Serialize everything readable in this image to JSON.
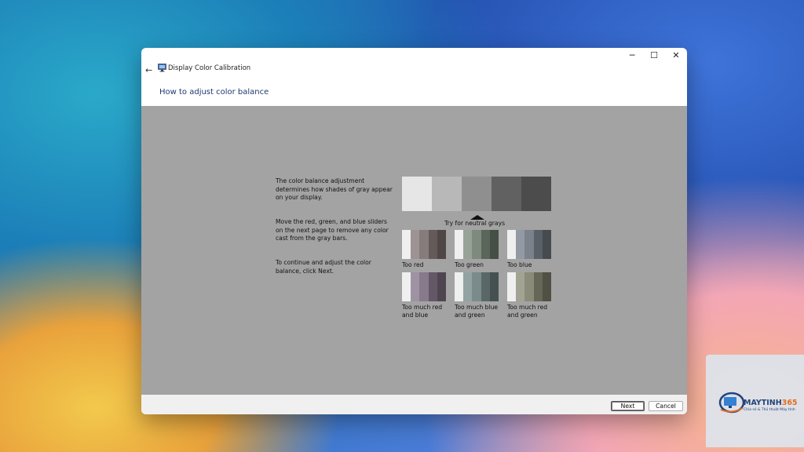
{
  "window": {
    "title": "Display Color Calibration",
    "heading": "How to adjust color balance",
    "controls": {
      "minimize": "─",
      "maximize": "☐",
      "close": "✕"
    },
    "back_glyph": "←"
  },
  "content": {
    "paragraph1": "The color balance adjustment determines how shades of gray appear on your display.",
    "paragraph2": "Move the red, green, and blue sliders on the next page to remove any color cast from the gray bars.",
    "paragraph3": "To continue and adjust the color balance, click Next.",
    "neutral_caption": "Try for neutral grays",
    "gray_bar_colors": [
      "#e6e6e6",
      "#b8b8b8",
      "#8f8f8f",
      "#616161",
      "#4c4c4c"
    ],
    "samples": [
      {
        "label": "Too red",
        "colors": [
          "#efefef",
          "#9d9393",
          "#877c7c",
          "#655a5a",
          "#4f4646"
        ]
      },
      {
        "label": "Too green",
        "colors": [
          "#efefef",
          "#98a398",
          "#7d8a7d",
          "#5a665a",
          "#464f46"
        ]
      },
      {
        "label": "Too blue",
        "colors": [
          "#efefef",
          "#949aa3",
          "#7c828b",
          "#5a6067",
          "#464b50"
        ]
      },
      {
        "label": "Too much red and blue",
        "colors": [
          "#efefef",
          "#9e93a3",
          "#867a8b",
          "#645867",
          "#4f4551"
        ]
      },
      {
        "label": "Too much blue and green",
        "colors": [
          "#efefef",
          "#93a3a3",
          "#7b8b8b",
          "#596767",
          "#455151"
        ]
      },
      {
        "label": "Too much red and green",
        "colors": [
          "#efefef",
          "#a3a393",
          "#8b8b7a",
          "#676758",
          "#505045"
        ]
      }
    ]
  },
  "footer": {
    "next_label": "Next",
    "cancel_label": "Cancel"
  },
  "brand": {
    "name_main": "MAYTINH",
    "name_accent": "365",
    "tagline": "Chia sẻ & Thủ thuật Máy tính"
  }
}
